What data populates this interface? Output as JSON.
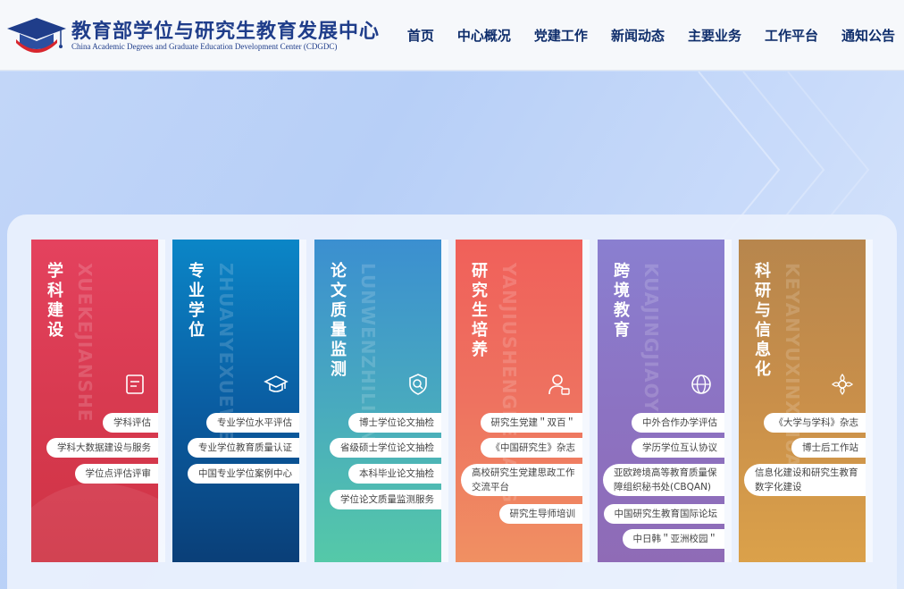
{
  "header": {
    "brand_cn": "教育部学位与研究生教育发展中心",
    "brand_en": "China Academic Degrees and Graduate Education Development Center (CDGDC)",
    "nav": [
      "首页",
      "中心概况",
      "党建工作",
      "新闻动态",
      "主要业务",
      "工作平台",
      "通知公告"
    ]
  },
  "colors": {
    "nav_text": "#0e2d6b",
    "brand": "#1f3d8a",
    "logo_red": "#d8262e"
  },
  "cards": [
    {
      "title": "学科建设",
      "bg_word": "XUEKEJIANSHE",
      "icon": "document-icon",
      "items": [
        "学科评估",
        "学科大数据建设与服务",
        "学位点评估评审"
      ]
    },
    {
      "title": "专业学位",
      "bg_word": "ZHUANYEXUEWEI",
      "icon": "graduation-cap-icon",
      "items": [
        "专业学位水平评估",
        "专业学位教育质量认证",
        "中国专业学位案例中心"
      ]
    },
    {
      "title": "论文质量监测",
      "bg_word": "LUNWENZHILIANG",
      "icon": "shield-search-icon",
      "items": [
        "博士学位论文抽检",
        "省级硕士学位论文抽检",
        "本科毕业论文抽检",
        "学位论文质量监测服务"
      ]
    },
    {
      "title": "研究生培养",
      "bg_word": "YANJIUSHENGPEIYANG",
      "icon": "user-badge-icon",
      "items": [
        "研究生党建＂双百＂",
        "《中国研究生》杂志",
        "高校研究生党建思政工作交流平台",
        "研究生导师培训"
      ]
    },
    {
      "title": "跨境教育",
      "bg_word": "KUAJINGJIAOYU",
      "icon": "globe-icon",
      "items": [
        "中外合作办学评估",
        "学历学位互认协议",
        "亚欧跨境高等教育质量保障组织秘书处(CBQAN)",
        "中国研究生教育国际论坛",
        "中日韩＂亚洲校园＂"
      ]
    },
    {
      "title": "科研与信息化",
      "bg_word": "KEYANYUXINXIHUA",
      "icon": "flower-gear-icon",
      "items": [
        "《大学与学科》杂志",
        "博士后工作站",
        "信息化建设和研究生教育数字化建设"
      ]
    }
  ]
}
